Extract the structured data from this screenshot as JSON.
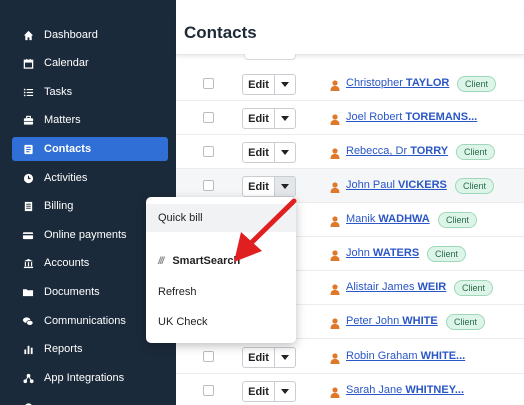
{
  "sidebar": {
    "items": [
      {
        "label": "Dashboard",
        "icon": "home-icon"
      },
      {
        "label": "Calendar",
        "icon": "calendar-icon"
      },
      {
        "label": "Tasks",
        "icon": "tasks-icon"
      },
      {
        "label": "Matters",
        "icon": "briefcase-icon"
      },
      {
        "label": "Contacts",
        "icon": "contact-card-icon",
        "active": true
      },
      {
        "label": "Activities",
        "icon": "clock-icon"
      },
      {
        "label": "Billing",
        "icon": "receipt-icon"
      },
      {
        "label": "Online payments",
        "icon": "credit-card-icon"
      },
      {
        "label": "Accounts",
        "icon": "bank-icon"
      },
      {
        "label": "Documents",
        "icon": "folder-icon"
      },
      {
        "label": "Communications",
        "icon": "chat-icon"
      },
      {
        "label": "Reports",
        "icon": "bar-chart-icon"
      },
      {
        "label": "App Integrations",
        "icon": "integrations-icon"
      }
    ]
  },
  "header": {
    "title": "Contacts"
  },
  "rows": [
    {
      "edit_label": "Edit",
      "first": "Christopher",
      "last": "TAYLOR",
      "badge": "Client"
    },
    {
      "edit_label": "Edit",
      "first": "Joel Robert",
      "last": "TOREMANS...",
      "badge": ""
    },
    {
      "edit_label": "Edit",
      "first": "Rebecca, Dr",
      "last": "TORRY",
      "badge": "Client"
    },
    {
      "edit_label": "Edit",
      "first": "John Paul",
      "last": "VICKERS",
      "badge": "Client"
    },
    {
      "edit_label": "Edit",
      "first": "Manik",
      "last": "WADHWA",
      "badge": "Client"
    },
    {
      "edit_label": "Edit",
      "first": "John",
      "last": "WATERS",
      "badge": "Client"
    },
    {
      "edit_label": "Edit",
      "first": "Alistair James",
      "last": "WEIR",
      "badge": "Client"
    },
    {
      "edit_label": "Edit",
      "first": "Peter John",
      "last": "WHITE",
      "badge": "Client"
    },
    {
      "edit_label": "Edit",
      "first": "Robin Graham",
      "last": "WHITE...",
      "badge": ""
    },
    {
      "edit_label": "Edit",
      "first": "Sarah Jane",
      "last": "WHITNEY...",
      "badge": ""
    }
  ],
  "dropdown": {
    "items": [
      {
        "label": "Quick bill"
      },
      {
        "label": "SmartSearch",
        "mark": "///"
      },
      {
        "label": "Refresh"
      },
      {
        "label": "UK Check"
      }
    ]
  },
  "colors": {
    "sidebar_bg": "#1b2a3a",
    "active_nav": "#2f6fd6",
    "link": "#2a56c6",
    "person_icon": "#e0782a",
    "badge_bg": "#dcf5e8",
    "arrow": "#e02020"
  }
}
